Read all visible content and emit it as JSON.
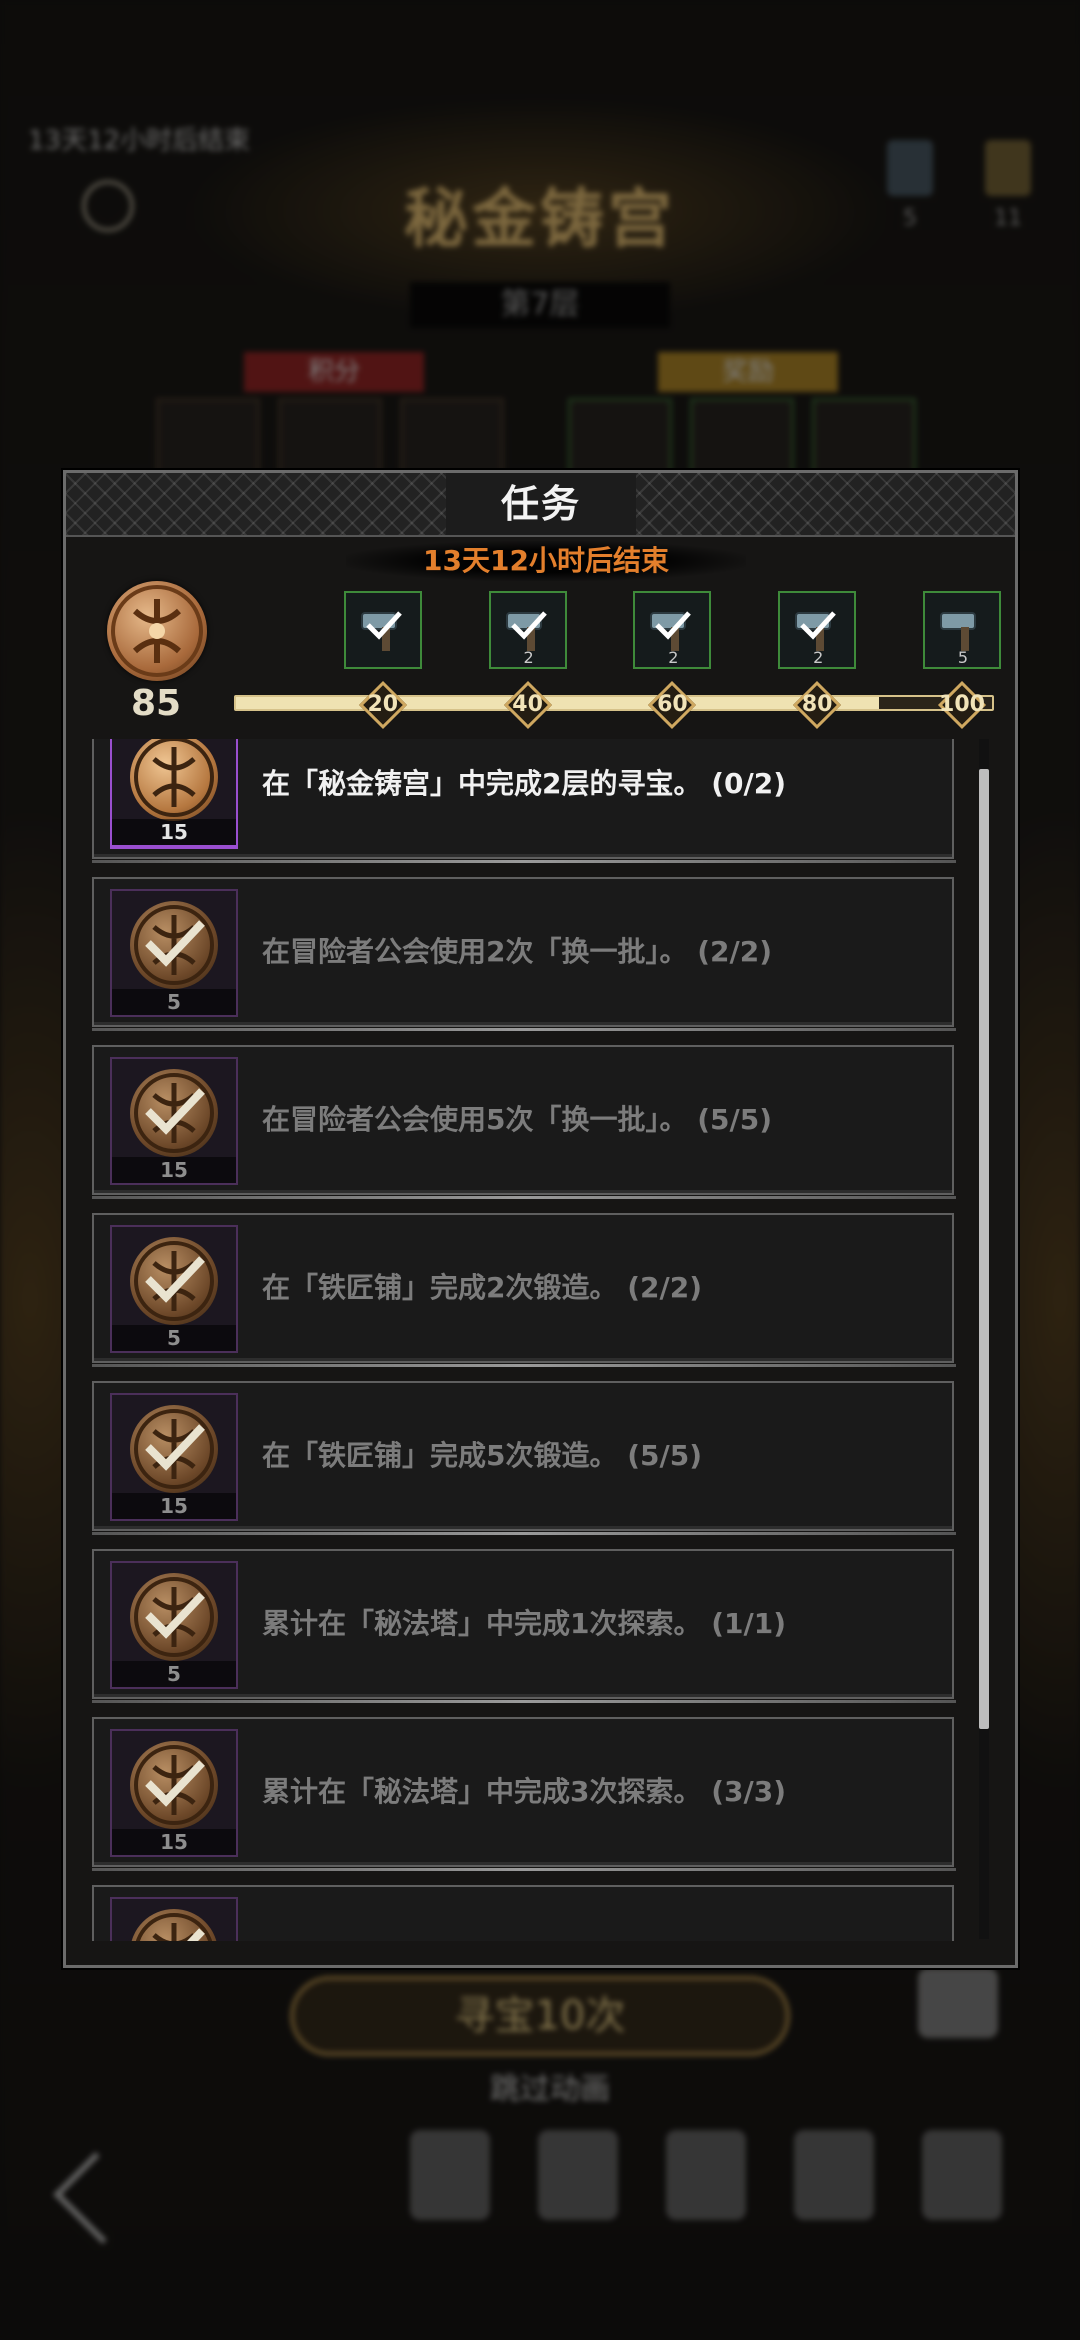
{
  "background": {
    "countdown": "13天12小时后结束",
    "title": "秘金铸宫",
    "floor": "第7层",
    "resources": [
      {
        "value": "5"
      },
      {
        "value": "11"
      }
    ],
    "tags": [
      "积分",
      "奖励"
    ],
    "main_button": "寻宝10次",
    "skip_label": "跳过动画",
    "nav_items": [
      "",
      "",
      "",
      "",
      ""
    ]
  },
  "dialog": {
    "title": "任务",
    "countdown": "13天12小时后结束",
    "points": "85",
    "progress": {
      "current": 85,
      "max": 100
    },
    "milestones": [
      "20",
      "40",
      "60",
      "80",
      "100"
    ],
    "rewards": [
      {
        "qty": "",
        "claimed": true
      },
      {
        "qty": "2",
        "claimed": true
      },
      {
        "qty": "2",
        "claimed": true
      },
      {
        "qty": "2",
        "claimed": true
      },
      {
        "qty": "5",
        "claimed": false
      }
    ],
    "tasks": [
      {
        "points": "15",
        "text": "在「秘金铸宫」中完成2层的寻宝。 (0/2)",
        "done": false
      },
      {
        "points": "5",
        "text": "在冒险者公会使用2次「换一批」。 (2/2)",
        "done": true
      },
      {
        "points": "15",
        "text": "在冒险者公会使用5次「换一批」。 (5/5)",
        "done": true
      },
      {
        "points": "5",
        "text": "在「铁匠铺」完成2次锻造。 (2/2)",
        "done": true
      },
      {
        "points": "15",
        "text": "在「铁匠铺」完成5次锻造。 (5/5)",
        "done": true
      },
      {
        "points": "5",
        "text": "累计在「秘法塔」中完成1次探索。 (1/1)",
        "done": true
      },
      {
        "points": "15",
        "text": "累计在「秘法塔」中完成3次探索。 (3/3)",
        "done": true
      },
      {
        "points": "",
        "text": "",
        "done": true
      }
    ]
  },
  "colors": {
    "countdown_orange": "#e37f2c",
    "reward_border_green": "#3e8a3a",
    "active_task_border": "#9a4fd0",
    "gold": "#cfa860"
  }
}
